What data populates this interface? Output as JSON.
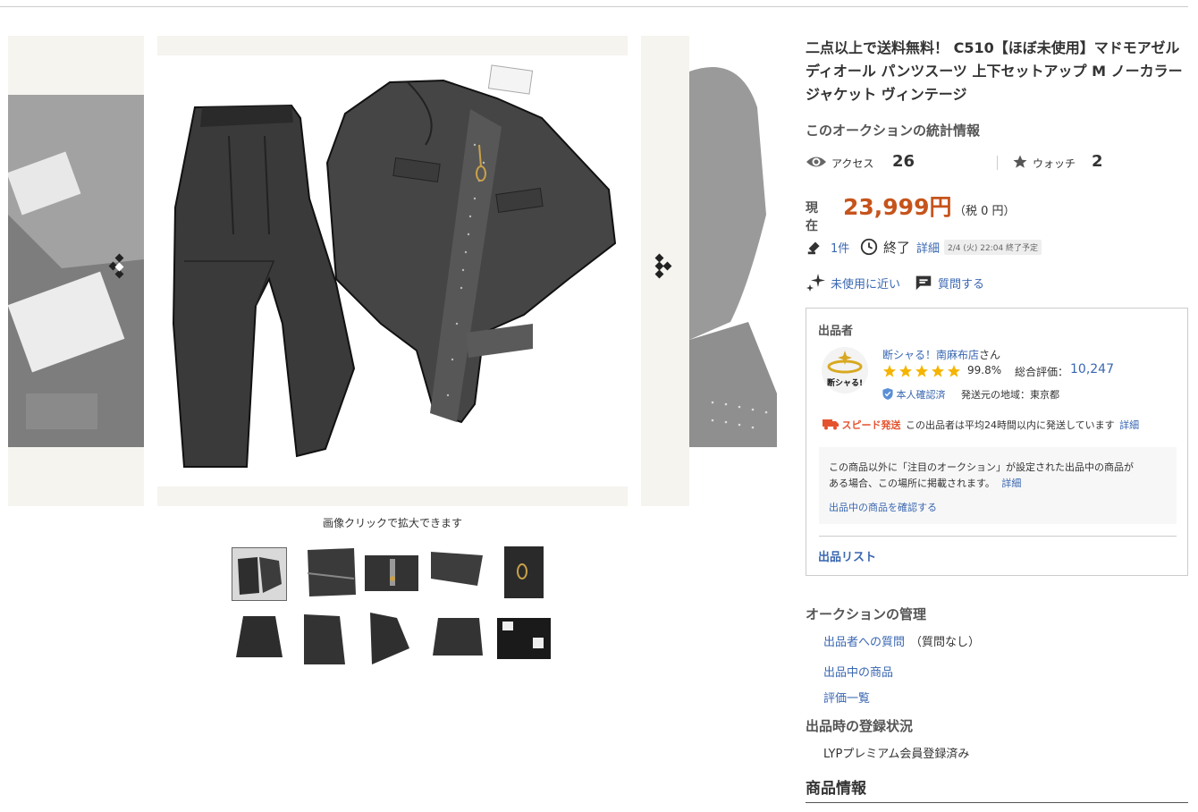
{
  "title": "二点以上で送料無料！ C510【ほぼ未使用】マドモアゼルディオール パンツスーツ 上下セットアップ M ノーカラージャケット ヴィンテージ",
  "title_lines": [
    "二点以上で送料無料！ C510【ほぼ未使用】マドモアゼル",
    "ディオール パンツスーツ 上下セットアップ M ノーカラー",
    "ジャケット ヴィンテージ"
  ],
  "stats": {
    "heading": "このオークションの統計情報",
    "access_label": "アクセス",
    "access_value": "26",
    "watch_label": "ウォッチ",
    "watch_value": "2"
  },
  "price": {
    "label": "現在",
    "value": "23,999円",
    "tax": "（税 0 円）"
  },
  "bids": {
    "count": "1件",
    "end_label": "終了",
    "detail": "詳細",
    "end_time": "2/4 (火) 22:04 終了予定"
  },
  "condition": {
    "label": "未使用に近い",
    "ask": "質問する"
  },
  "seller": {
    "heading": "出品者",
    "name": "断シャる！南麻布店",
    "suffix": "さん",
    "rating_pct": "99.8%",
    "score_label": "総合評価：",
    "score": "10,247",
    "verified": "本人確認済",
    "location": "発送元の地域：東京都",
    "speed_label": "スピード発送",
    "speed_text": "この出品者は平均24時間以内に発送しています",
    "speed_detail": "詳細",
    "avatar_text": "断シャる!",
    "stars": 5
  },
  "notice": {
    "line1": "この商品以外に「注目のオークション」が設定された出品中の商品が",
    "line2": "ある場合、この場所に掲載されます。",
    "detail": "詳細",
    "link": "出品中の商品を確認する"
  },
  "list_link": "出品リスト",
  "management": {
    "heading": "オークションの管理",
    "question_link": "出品者への質問",
    "question_status": "（質問なし）",
    "items_link": "出品中の商品",
    "reviews_link": "評価一覧"
  },
  "registration": {
    "heading": "出品時の登録状況",
    "value": "LYPプレミアム会員登録済み"
  },
  "product_info_heading": "商品情報",
  "gallery": {
    "caption": "画像クリックで拡大できます",
    "thumbnail_count": 10,
    "selected_index": 0
  },
  "colors": {
    "price": "#c6541c",
    "link": "#3a67b1",
    "star": "#f5b400",
    "speed": "#e5532e"
  }
}
